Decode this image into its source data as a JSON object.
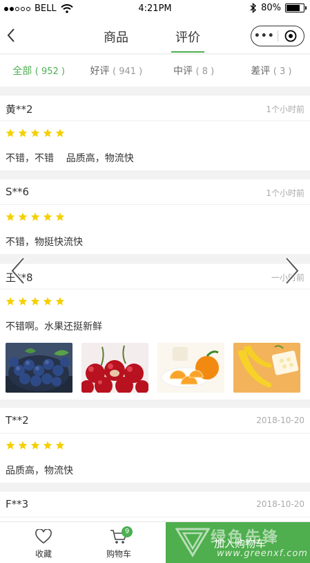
{
  "status_bar": {
    "carrier": "BELL",
    "time": "4:21PM",
    "battery": "80%",
    "battery_level": 0.8
  },
  "nav": {
    "tabs": [
      {
        "label": "商品",
        "active": false
      },
      {
        "label": "评价",
        "active": true
      }
    ],
    "more_label": "•••"
  },
  "filters": [
    {
      "label": "全部",
      "count": "( 952 )",
      "active": true
    },
    {
      "label": "好评",
      "count": "( 941 )",
      "active": false
    },
    {
      "label": "中评",
      "count": "( 8 )",
      "active": false
    },
    {
      "label": "差评",
      "count": "( 3 )",
      "active": false
    }
  ],
  "reviews": [
    {
      "user": "黄**2",
      "time": "1个小时前",
      "stars": 5,
      "text": "不错，不错    品质高，物流快",
      "images": []
    },
    {
      "user": "S**6",
      "time": "1个小时前",
      "stars": 5,
      "text": "不错，物挺快流快",
      "images": []
    },
    {
      "user": "王**8",
      "time": "一小时前",
      "stars": 5,
      "text": "不错啊。水果还挺新鲜",
      "images": [
        "blueberries-image",
        "cherries-image",
        "oranges-image",
        "bananas-image"
      ]
    },
    {
      "user": "T**2",
      "time": "2018-10-20",
      "stars": 5,
      "text": "品质高，物流快",
      "images": []
    },
    {
      "user": "F**3",
      "time": "2018-10-20",
      "stars": 5,
      "text": "",
      "images": []
    }
  ],
  "bottom_bar": {
    "favorite_label": "收藏",
    "cart_label": "购物车",
    "cart_count": "9",
    "add_to_cart_label": "加入购物车"
  },
  "watermark": {
    "text_cn": "绿色先锋",
    "url": "www.greenxf.com"
  },
  "colors": {
    "accent": "#4caf50",
    "star": "#f5d000",
    "add_cart_bg": "#4fae4e"
  }
}
